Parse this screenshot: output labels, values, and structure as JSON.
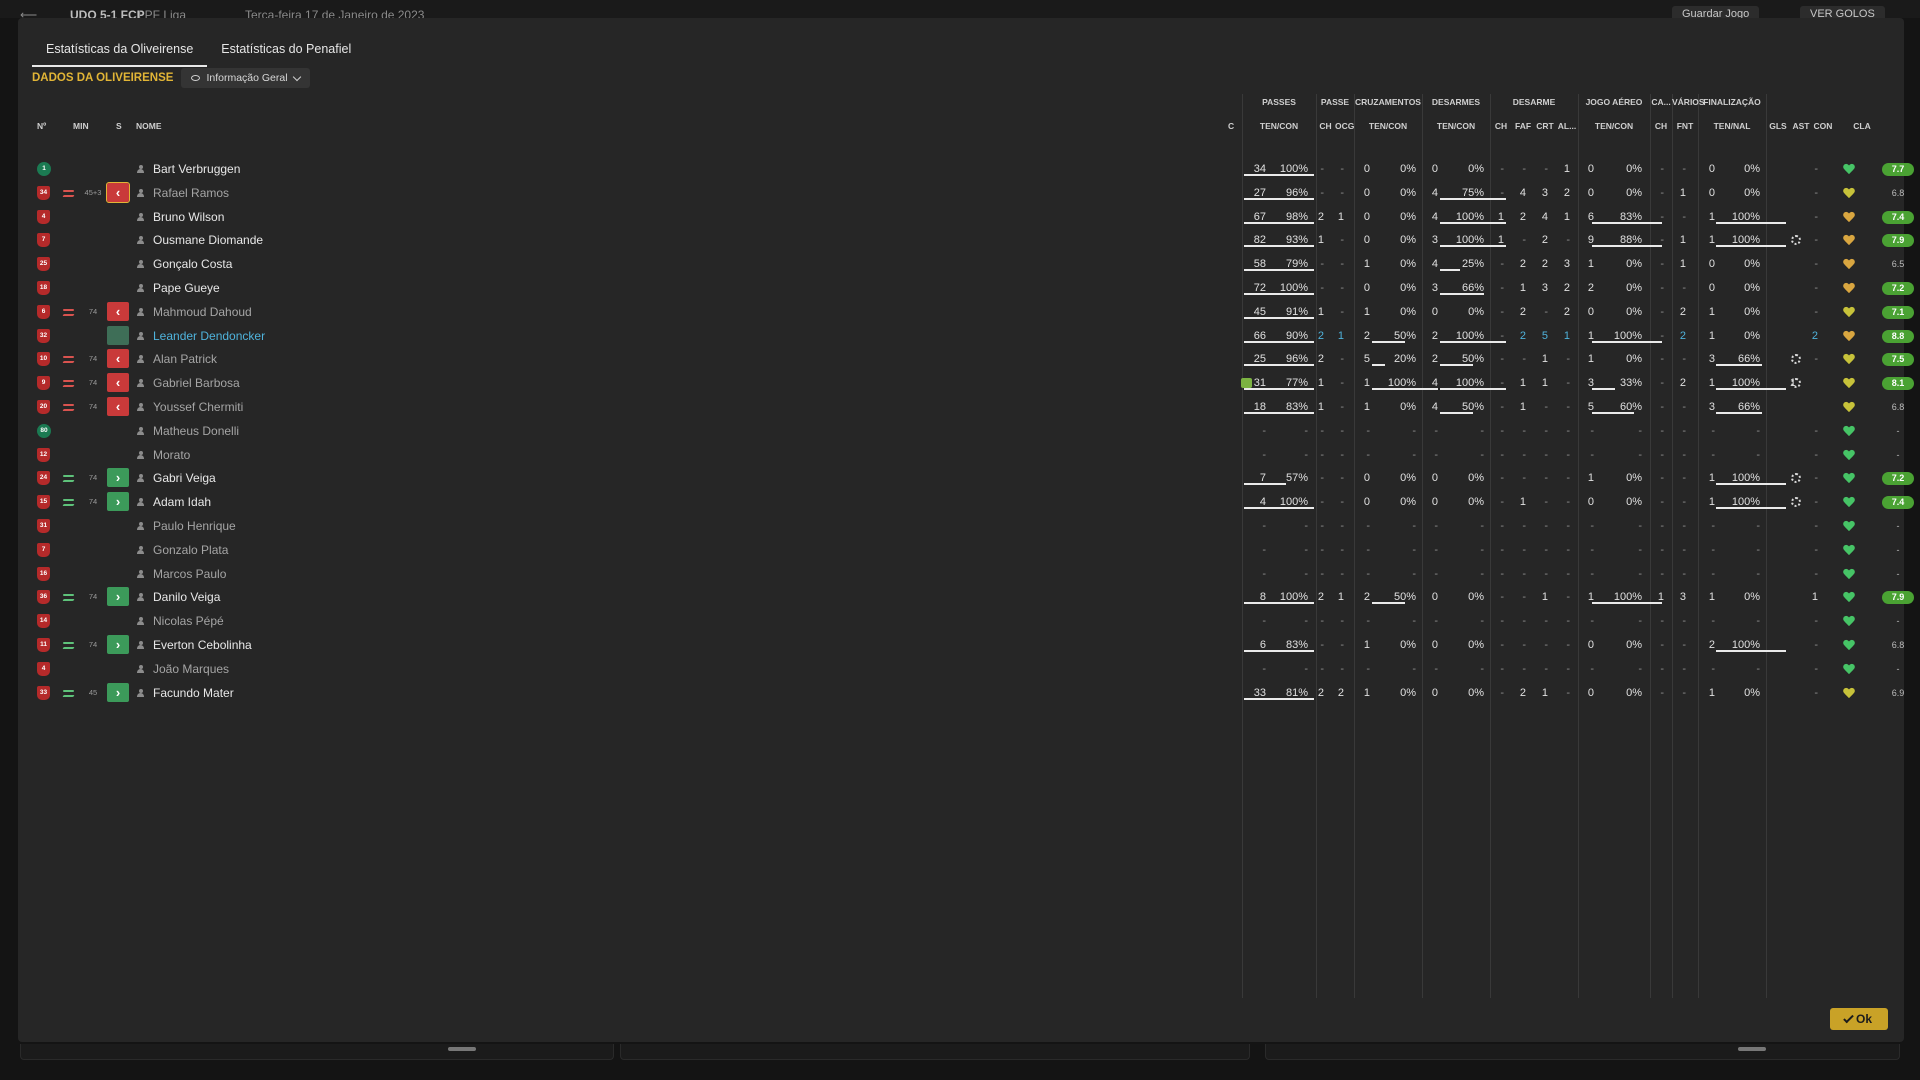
{
  "bg": {
    "score": "UDO 5-1 FCP",
    "league": "LPF Liga",
    "date": "Terça-feira 17 de Janeiro de 2023",
    "save_label": "Guardar Jogo",
    "ver_label": "VER GOLOS"
  },
  "tabs": [
    "Estatísticas da Oliveirense",
    "Estatísticas do Penafiel"
  ],
  "section_label": "DADOS DA OLIVEIRENSE",
  "view_select": "Informação Geral",
  "ok_label": "Ok",
  "headers": {
    "num": "Nº",
    "min": "MIN",
    "s": "S",
    "nome": "NOME",
    "c": "C",
    "groups": [
      "PASSES",
      "PASSE",
      "CRUZAMENTOS",
      "DESARMES",
      "DESARME",
      "JOGO AÉREO",
      "CA...",
      "VÁRIOS",
      "FINALIZAÇÃO"
    ],
    "subs": [
      "TEN/CON",
      "CH",
      "OCG",
      "TEN/CON",
      "TEN/CON",
      "CH",
      "FAF",
      "CRT",
      "AL...",
      "TEN/CON",
      "CH",
      "FNT",
      "TEN/NAL",
      "GLS",
      "AST",
      "CON",
      "CLA"
    ]
  },
  "players": [
    {
      "num": "1",
      "gk": true,
      "sub": "",
      "min": "",
      "s": "",
      "name": "Bart Verbruggen",
      "style": "",
      "pa": "34",
      "pp": "100%",
      "ch": "-",
      "ocg": "-",
      "cr": "0",
      "crp": "0%",
      "de": "0",
      "dep": "0%",
      "d1": "-",
      "d2": "-",
      "d3": "-",
      "d4": "1",
      "ja": "0",
      "jap": "0%",
      "ca": "-",
      "fnt": "-",
      "fi": "0",
      "fip": "0%",
      "gls": "",
      "ast": "-",
      "heart": "green",
      "cla": "7.7",
      "hi": true,
      "ul": [
        1,
        0,
        0,
        0
      ],
      "cog": false,
      "flag": false
    },
    {
      "num": "34",
      "gk": false,
      "sub": "out",
      "min": "45+3",
      "s": "out",
      "sel": true,
      "name": "Rafael Ramos",
      "style": "dim",
      "pa": "27",
      "pp": "96%",
      "ch": "-",
      "ocg": "-",
      "cr": "0",
      "crp": "0%",
      "de": "4",
      "dep": "75%",
      "d1": "-",
      "d2": "4",
      "d3": "3",
      "d4": "2",
      "ja": "0",
      "jap": "0%",
      "ca": "-",
      "fnt": "1",
      "fi": "0",
      "fip": "0%",
      "gls": "",
      "ast": "-",
      "heart": "yellow",
      "cla": "6.8",
      "hi": false,
      "ul": [
        1,
        0,
        1,
        0
      ],
      "cog": false,
      "flag": false,
      "dimstats": true
    },
    {
      "num": "4",
      "gk": false,
      "sub": "",
      "min": "",
      "s": "",
      "name": "Bruno Wilson",
      "style": "",
      "pa": "67",
      "pp": "98%",
      "ch": "2",
      "ocg": "1",
      "cr": "0",
      "crp": "0%",
      "de": "4",
      "dep": "100%",
      "d1": "1",
      "d2": "2",
      "d3": "4",
      "d4": "1",
      "ja": "6",
      "jap": "83%",
      "ca": "-",
      "fnt": "-",
      "fi": "1",
      "fip": "100%",
      "gls": "",
      "ast": "-",
      "heart": "orange",
      "cla": "7.4",
      "hi": true,
      "ul": [
        1,
        0,
        1,
        1,
        1
      ],
      "cog": false,
      "flag": false
    },
    {
      "num": "7",
      "gk": false,
      "sub": "",
      "min": "",
      "s": "",
      "name": "Ousmane Diomande",
      "style": "",
      "pa": "82",
      "pp": "93%",
      "ch": "1",
      "ocg": "-",
      "cr": "0",
      "crp": "0%",
      "de": "3",
      "dep": "100%",
      "d1": "1",
      "d2": "-",
      "d3": "2",
      "d4": "-",
      "ja": "9",
      "jap": "88%",
      "ca": "-",
      "fnt": "1",
      "fi": "1",
      "fip": "100%",
      "gls": "",
      "ast": "-",
      "heart": "orange",
      "cla": "7.9",
      "hi": true,
      "ul": [
        1,
        0,
        1,
        1,
        1
      ],
      "cog": true,
      "flag": false
    },
    {
      "num": "25",
      "gk": false,
      "sub": "",
      "min": "",
      "s": "",
      "name": "Gonçalo Costa",
      "style": "",
      "pa": "58",
      "pp": "79%",
      "ch": "-",
      "ocg": "-",
      "cr": "1",
      "crp": "0%",
      "de": "4",
      "dep": "25%",
      "d1": "-",
      "d2": "2",
      "d3": "2",
      "d4": "3",
      "ja": "1",
      "jap": "0%",
      "ca": "-",
      "fnt": "1",
      "fi": "0",
      "fip": "0%",
      "gls": "",
      "ast": "-",
      "heart": "orange",
      "cla": "6.5",
      "hi": false,
      "ul": [
        1,
        0,
        0.3,
        0,
        0
      ],
      "cog": false,
      "flag": false
    },
    {
      "num": "18",
      "gk": false,
      "sub": "",
      "min": "",
      "s": "",
      "name": "Pape Gueye",
      "style": "",
      "pa": "72",
      "pp": "100%",
      "ch": "-",
      "ocg": "-",
      "cr": "0",
      "crp": "0%",
      "de": "3",
      "dep": "66%",
      "d1": "-",
      "d2": "1",
      "d3": "3",
      "d4": "2",
      "ja": "2",
      "jap": "0%",
      "ca": "-",
      "fnt": "-",
      "fi": "0",
      "fip": "0%",
      "gls": "",
      "ast": "-",
      "heart": "orange",
      "cla": "7.2",
      "hi": true,
      "ul": [
        1,
        0,
        0.66,
        0,
        0
      ],
      "cog": false,
      "flag": false
    },
    {
      "num": "6",
      "gk": false,
      "sub": "out",
      "min": "74",
      "s": "out",
      "name": "Mahmoud Dahoud",
      "style": "dim",
      "pa": "45",
      "pp": "91%",
      "ch": "1",
      "ocg": "-",
      "cr": "1",
      "crp": "0%",
      "de": "0",
      "dep": "0%",
      "d1": "-",
      "d2": "2",
      "d3": "-",
      "d4": "2",
      "ja": "0",
      "jap": "0%",
      "ca": "-",
      "fnt": "2",
      "fi": "1",
      "fip": "0%",
      "gls": "",
      "ast": "-",
      "heart": "yellow",
      "cla": "7.1",
      "hi": true,
      "ul": [
        1,
        0,
        0,
        0,
        0
      ],
      "cog": false,
      "flag": false,
      "dimstats": true
    },
    {
      "num": "32",
      "gk": false,
      "sub": "",
      "min": "",
      "s": "hdj",
      "name": "Leander Dendoncker",
      "style": "link",
      "pa": "66",
      "pp": "90%",
      "ch": "2",
      "ocg": "1",
      "cr": "2",
      "crp": "50%",
      "de": "2",
      "dep": "100%",
      "d1": "-",
      "d2": "2",
      "d3": "5",
      "d4": "1",
      "ja": "1",
      "jap": "100%",
      "ca": "-",
      "fnt": "2",
      "fi": "1",
      "fip": "0%",
      "gls": "",
      "ast": "2",
      "heart": "orange",
      "cla": "8.8",
      "hi": true,
      "ul": [
        1,
        0.5,
        1,
        1,
        0
      ],
      "cog": false,
      "flag": false,
      "blue": true
    },
    {
      "num": "10",
      "gk": false,
      "sub": "out",
      "min": "74",
      "s": "out",
      "name": "Alan Patrick",
      "style": "dim",
      "pa": "25",
      "pp": "96%",
      "ch": "2",
      "ocg": "-",
      "cr": "5",
      "crp": "20%",
      "de": "2",
      "dep": "50%",
      "d1": "-",
      "d2": "-",
      "d3": "1",
      "d4": "-",
      "ja": "1",
      "jap": "0%",
      "ca": "-",
      "fnt": "-",
      "fi": "3",
      "fip": "66%",
      "gls": "",
      "ast": "-",
      "heart": "yellow",
      "cla": "7.5",
      "hi": true,
      "ul": [
        1,
        0.2,
        0.5,
        0,
        0.66
      ],
      "cog": true,
      "flag": false,
      "dimstats": true
    },
    {
      "num": "9",
      "gk": false,
      "sub": "out",
      "min": "74",
      "s": "out",
      "name": "Gabriel Barbosa",
      "style": "dim",
      "pa": "31",
      "pp": "77%",
      "ch": "1",
      "ocg": "-",
      "cr": "1",
      "crp": "100%",
      "de": "4",
      "dep": "100%",
      "d1": "-",
      "d2": "1",
      "d3": "1",
      "d4": "-",
      "ja": "3",
      "jap": "33%",
      "ca": "-",
      "fnt": "2",
      "fi": "1",
      "fip": "100%",
      "gls": "1",
      "ast": "",
      "heart": "yellow",
      "cla": "8.1",
      "hi": true,
      "ul": [
        1,
        1,
        1,
        0.33,
        1
      ],
      "cog": true,
      "flag": true,
      "dimstats": true
    },
    {
      "num": "20",
      "gk": false,
      "sub": "out",
      "min": "74",
      "s": "out",
      "name": "Youssef Chermiti",
      "style": "dim",
      "pa": "18",
      "pp": "83%",
      "ch": "1",
      "ocg": "-",
      "cr": "1",
      "crp": "0%",
      "de": "4",
      "dep": "50%",
      "d1": "-",
      "d2": "1",
      "d3": "-",
      "d4": "-",
      "ja": "5",
      "jap": "60%",
      "ca": "-",
      "fnt": "-",
      "fi": "3",
      "fip": "66%",
      "gls": "",
      "ast": "",
      "heart": "yellow",
      "cla": "6.8",
      "hi": false,
      "ul": [
        1,
        0,
        0.5,
        0.6,
        0.66
      ],
      "cog": false,
      "flag": false,
      "dimstats": true
    },
    {
      "num": "80",
      "gk": true,
      "sub": "",
      "min": "",
      "s": "",
      "name": "Matheus Donelli",
      "style": "dim",
      "empty": true,
      "heart": "green",
      "cla": "-",
      "hi": false
    },
    {
      "num": "12",
      "gk": false,
      "sub": "",
      "min": "",
      "s": "",
      "name": "Morato",
      "style": "dim",
      "empty": true,
      "heart": "green",
      "cla": "-",
      "hi": false
    },
    {
      "num": "24",
      "gk": false,
      "sub": "in",
      "min": "74",
      "s": "in",
      "name": "Gabri Veiga",
      "style": "",
      "pa": "7",
      "pp": "57%",
      "ch": "-",
      "ocg": "-",
      "cr": "0",
      "crp": "0%",
      "de": "0",
      "dep": "0%",
      "d1": "-",
      "d2": "-",
      "d3": "-",
      "d4": "-",
      "ja": "1",
      "jap": "0%",
      "ca": "-",
      "fnt": "-",
      "fi": "1",
      "fip": "100%",
      "gls": "",
      "ast": "-",
      "heart": "green",
      "cla": "7.2",
      "hi": true,
      "ul": [
        0.6,
        0,
        0,
        0,
        1
      ],
      "cog": true,
      "flag": false
    },
    {
      "num": "15",
      "gk": false,
      "sub": "in",
      "min": "74",
      "s": "in",
      "name": "Adam Idah",
      "style": "",
      "pa": "4",
      "pp": "100%",
      "ch": "-",
      "ocg": "-",
      "cr": "0",
      "crp": "0%",
      "de": "0",
      "dep": "0%",
      "d1": "-",
      "d2": "1",
      "d3": "-",
      "d4": "-",
      "ja": "0",
      "jap": "0%",
      "ca": "-",
      "fnt": "-",
      "fi": "1",
      "fip": "100%",
      "gls": "",
      "ast": "-",
      "heart": "green",
      "cla": "7.4",
      "hi": true,
      "ul": [
        1,
        0,
        0,
        0,
        1
      ],
      "cog": true,
      "flag": false
    },
    {
      "num": "31",
      "gk": false,
      "sub": "",
      "min": "",
      "s": "",
      "name": "Paulo Henrique",
      "style": "dim",
      "empty": true,
      "heart": "green",
      "cla": "-",
      "hi": false
    },
    {
      "num": "7",
      "gk": false,
      "sub": "",
      "min": "",
      "s": "",
      "name": "Gonzalo Plata",
      "style": "dim",
      "empty": true,
      "heart": "green",
      "cla": "-",
      "hi": false
    },
    {
      "num": "16",
      "gk": false,
      "sub": "",
      "min": "",
      "s": "",
      "name": "Marcos Paulo",
      "style": "dim",
      "empty": true,
      "heart": "green",
      "cla": "-",
      "hi": false
    },
    {
      "num": "36",
      "gk": false,
      "sub": "in",
      "min": "74",
      "s": "in",
      "name": "Danilo Veiga",
      "style": "",
      "pa": "8",
      "pp": "100%",
      "ch": "2",
      "ocg": "1",
      "cr": "2",
      "crp": "50%",
      "de": "0",
      "dep": "0%",
      "d1": "-",
      "d2": "-",
      "d3": "1",
      "d4": "-",
      "ja": "1",
      "jap": "100%",
      "ca": "1",
      "fnt": "3",
      "fi": "1",
      "fip": "0%",
      "gls": "",
      "ast": "1",
      "heart": "green",
      "cla": "7.9",
      "hi": true,
      "ul": [
        1,
        0.5,
        0,
        1,
        0
      ],
      "cog": false,
      "flag": false
    },
    {
      "num": "14",
      "gk": false,
      "sub": "",
      "min": "",
      "s": "",
      "name": "Nicolas Pépé",
      "style": "dim",
      "empty": true,
      "heart": "green",
      "cla": "-",
      "hi": false
    },
    {
      "num": "11",
      "gk": false,
      "sub": "in",
      "min": "74",
      "s": "in",
      "name": "Everton Cebolinha",
      "style": "",
      "pa": "6",
      "pp": "83%",
      "ch": "-",
      "ocg": "-",
      "cr": "1",
      "crp": "0%",
      "de": "0",
      "dep": "0%",
      "d1": "-",
      "d2": "-",
      "d3": "-",
      "d4": "-",
      "ja": "0",
      "jap": "0%",
      "ca": "-",
      "fnt": "-",
      "fi": "2",
      "fip": "100%",
      "gls": "",
      "ast": "-",
      "heart": "green",
      "cla": "6.8",
      "hi": false,
      "ul": [
        1,
        0,
        0,
        0,
        1
      ],
      "cog": false,
      "flag": false
    },
    {
      "num": "4",
      "gk": false,
      "sub": "",
      "min": "",
      "s": "",
      "name": "João Marques",
      "style": "dim",
      "empty": true,
      "heart": "green",
      "cla": "-",
      "hi": false
    },
    {
      "num": "33",
      "gk": false,
      "sub": "in",
      "min": "45",
      "s": "in",
      "name": "Facundo Mater",
      "style": "",
      "pa": "33",
      "pp": "81%",
      "ch": "2",
      "ocg": "2",
      "cr": "1",
      "crp": "0%",
      "de": "0",
      "dep": "0%",
      "d1": "-",
      "d2": "2",
      "d3": "1",
      "d4": "-",
      "ja": "0",
      "jap": "0%",
      "ca": "-",
      "fnt": "-",
      "fi": "1",
      "fip": "0%",
      "gls": "",
      "ast": "-",
      "heart": "yellow",
      "cla": "6.9",
      "hi": false,
      "ul": [
        1,
        0,
        0,
        0,
        0
      ],
      "cog": false,
      "flag": false
    }
  ]
}
